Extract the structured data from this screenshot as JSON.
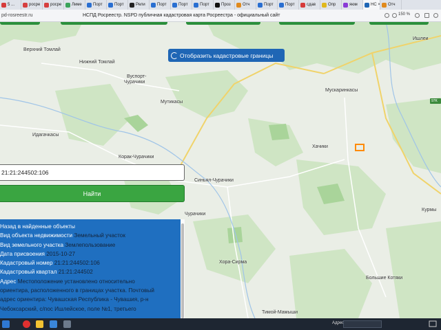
{
  "tabs": [
    {
      "label": "5 ...",
      "color": "#d63b3b"
    },
    {
      "label": "росре",
      "color": "#d64040"
    },
    {
      "label": "росре",
      "color": "#d64040"
    },
    {
      "label": "Лиме",
      "color": "#3ba35a"
    },
    {
      "label": "Порт",
      "color": "#2a6fd1"
    },
    {
      "label": "Порт",
      "color": "#2a6fd1"
    },
    {
      "label": "Рели",
      "color": "#222222"
    },
    {
      "label": "Порт",
      "color": "#2a6fd1"
    },
    {
      "label": "Порт",
      "color": "#2a6fd1"
    },
    {
      "label": "Порт",
      "color": "#2a6fd1"
    },
    {
      "label": "Проз",
      "color": "#111111"
    },
    {
      "label": "Отч",
      "color": "#e08a1e"
    },
    {
      "label": "Порт",
      "color": "#2a6fd1"
    },
    {
      "label": "Порт",
      "color": "#2a6fd1"
    },
    {
      "label": "сдав",
      "color": "#d63b3b"
    },
    {
      "label": "Опр",
      "color": "#e0b81e"
    },
    {
      "label": "яюм",
      "color": "#8a3bd6"
    },
    {
      "label": "НС ×",
      "color": "#1f66b5",
      "active": true
    },
    {
      "label": "Отч",
      "color": "#e08a1e"
    }
  ],
  "address_bar": {
    "url": "pd-rosreestr.ru",
    "title": "НСПД Росреестр. NSPD публичная кадастровая карта Росреестра - официальный сайт",
    "zoom": "150 %"
  },
  "map": {
    "cadastral_button_label": "Отобразить кадастровые границы",
    "places": [
      {
        "name": "Верхний Томлай"
      },
      {
        "name": "Нижний Томлай"
      },
      {
        "name": "Вуспорт-"
      },
      {
        "name": "Чурачики"
      },
      {
        "name": "Мутикасы"
      },
      {
        "name": "Ишлеи"
      },
      {
        "name": "Мускаринкасы"
      },
      {
        "name": "97K"
      },
      {
        "name": "Идагачкасы"
      },
      {
        "name": "Корак-Чурачики"
      },
      {
        "name": "Синьял-Чурачики"
      },
      {
        "name": "Хачики"
      },
      {
        "name": "Курмы"
      },
      {
        "name": "Хора-Сирма"
      },
      {
        "name": "Большие Котяки"
      },
      {
        "name": "Тимой-Мамыши"
      },
      {
        "name": "Чурачики"
      }
    ]
  },
  "search": {
    "value": "21:21:244502:106",
    "button_label": "Найти"
  },
  "info_panel": {
    "back_label": "Назад в найденные объекты",
    "rows": [
      {
        "key": "Вид объекта недвижимости",
        "value": "Земельный участок"
      },
      {
        "key": "Вид земельного участка",
        "value": "Землепользование"
      },
      {
        "key": "Дата присвоения",
        "value": "2015-10-27"
      },
      {
        "key": "Кадастровый номер",
        "value": "21:21:244502:106"
      },
      {
        "key": "Кадастровый квартал",
        "value": "21:21:244502"
      }
    ],
    "address_key": "Адрес",
    "address_lines": [
      "Местоположение установлено относительно",
      "ориентира, расположенного в границах участка. Почтовый",
      "адрес ориентира: Чувашская Республика - Чувашия, р-н",
      "Чебоксарский, с/пос Ишлейское, поле №1, третьего"
    ]
  },
  "taskbar": {
    "address_label": "Адрес"
  }
}
